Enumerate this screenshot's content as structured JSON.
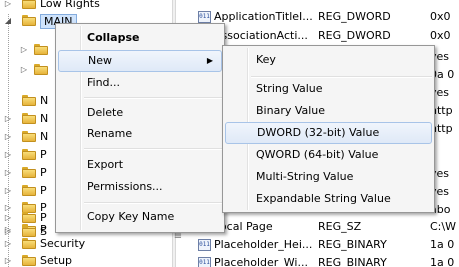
{
  "tree": {
    "items": [
      {
        "label": "Low Rights",
        "expander": "▷",
        "state": "collapsed"
      },
      {
        "label": "MAIN",
        "expander": "◢",
        "state": "expanded-selected"
      },
      {
        "label": "",
        "expander": "▷"
      },
      {
        "label": "",
        "expander": "▷"
      },
      {
        "label": "N",
        "expander": ""
      },
      {
        "label": "N",
        "expander": "▷"
      },
      {
        "label": "N",
        "expander": "▷"
      },
      {
        "label": "P",
        "expander": "▷"
      },
      {
        "label": "P",
        "expander": "▷"
      },
      {
        "label": "P",
        "expander": "▷"
      },
      {
        "label": "P",
        "expander": "▷"
      },
      {
        "label": "P",
        "expander": "▷"
      },
      {
        "label": "P",
        "expander": "▷"
      },
      {
        "label": "S",
        "expander": "▷"
      },
      {
        "label": "Security",
        "expander": "▷"
      },
      {
        "label": "Setup",
        "expander": "▷"
      }
    ]
  },
  "values": {
    "rows": [
      {
        "name": "ApplicationTitleI...",
        "type": "REG_DWORD",
        "data": "0x0",
        "icon": "011"
      },
      {
        "name": "AssociationActi...",
        "type": "REG_DWORD",
        "data": "0x0",
        "icon": "011"
      },
      {
        "name": "",
        "type": "",
        "data": "yes",
        "icon": ""
      },
      {
        "name": "",
        "type": "",
        "data": "0a 0",
        "icon": ""
      },
      {
        "name": "",
        "type": "",
        "data": "yes",
        "icon": ""
      },
      {
        "name": "",
        "type": "",
        "data": "http",
        "icon": ""
      },
      {
        "name": "",
        "type": "",
        "data": "http",
        "icon": ""
      },
      {
        "name": "",
        "type": "",
        "data": "",
        "icon": ""
      },
      {
        "name": "",
        "type": "",
        "data": "",
        "icon": ""
      },
      {
        "name": "",
        "type": "",
        "data": "yes",
        "icon": ""
      },
      {
        "name": "",
        "type": "",
        "data": "yes",
        "icon": ""
      },
      {
        "name": "",
        "type": "",
        "data": "abo",
        "icon": ""
      },
      {
        "name": "Local Page",
        "type": "REG_SZ",
        "data": "C:\\W",
        "icon": "ab"
      },
      {
        "name": "Placeholder_Hei...",
        "type": "REG_BINARY",
        "data": "1a 0",
        "icon": "011"
      },
      {
        "name": "Placeholder_Wi...",
        "type": "REG_BINARY",
        "data": "1a 0",
        "icon": "011"
      }
    ]
  },
  "context_menu": {
    "collapse": "Collapse",
    "new": "New",
    "find": "Find...",
    "delete": "Delete",
    "rename": "Rename",
    "export": "Export",
    "permissions": "Permissions...",
    "copy_key_name": "Copy Key Name",
    "arrow": "▶"
  },
  "submenu": {
    "key": "Key",
    "string_value": "String Value",
    "binary_value": "Binary Value",
    "dword_value": "DWORD (32-bit) Value",
    "qword_value": "QWORD (64-bit) Value",
    "multi_string_value": "Multi-String Value",
    "expandable_string_value": "Expandable String Value"
  },
  "colors": {
    "selection_fill": "#cfe3fb",
    "selection_border": "#84acdd",
    "menu_background": "#f5f5f5",
    "hover_border": "#a8c4e8"
  }
}
